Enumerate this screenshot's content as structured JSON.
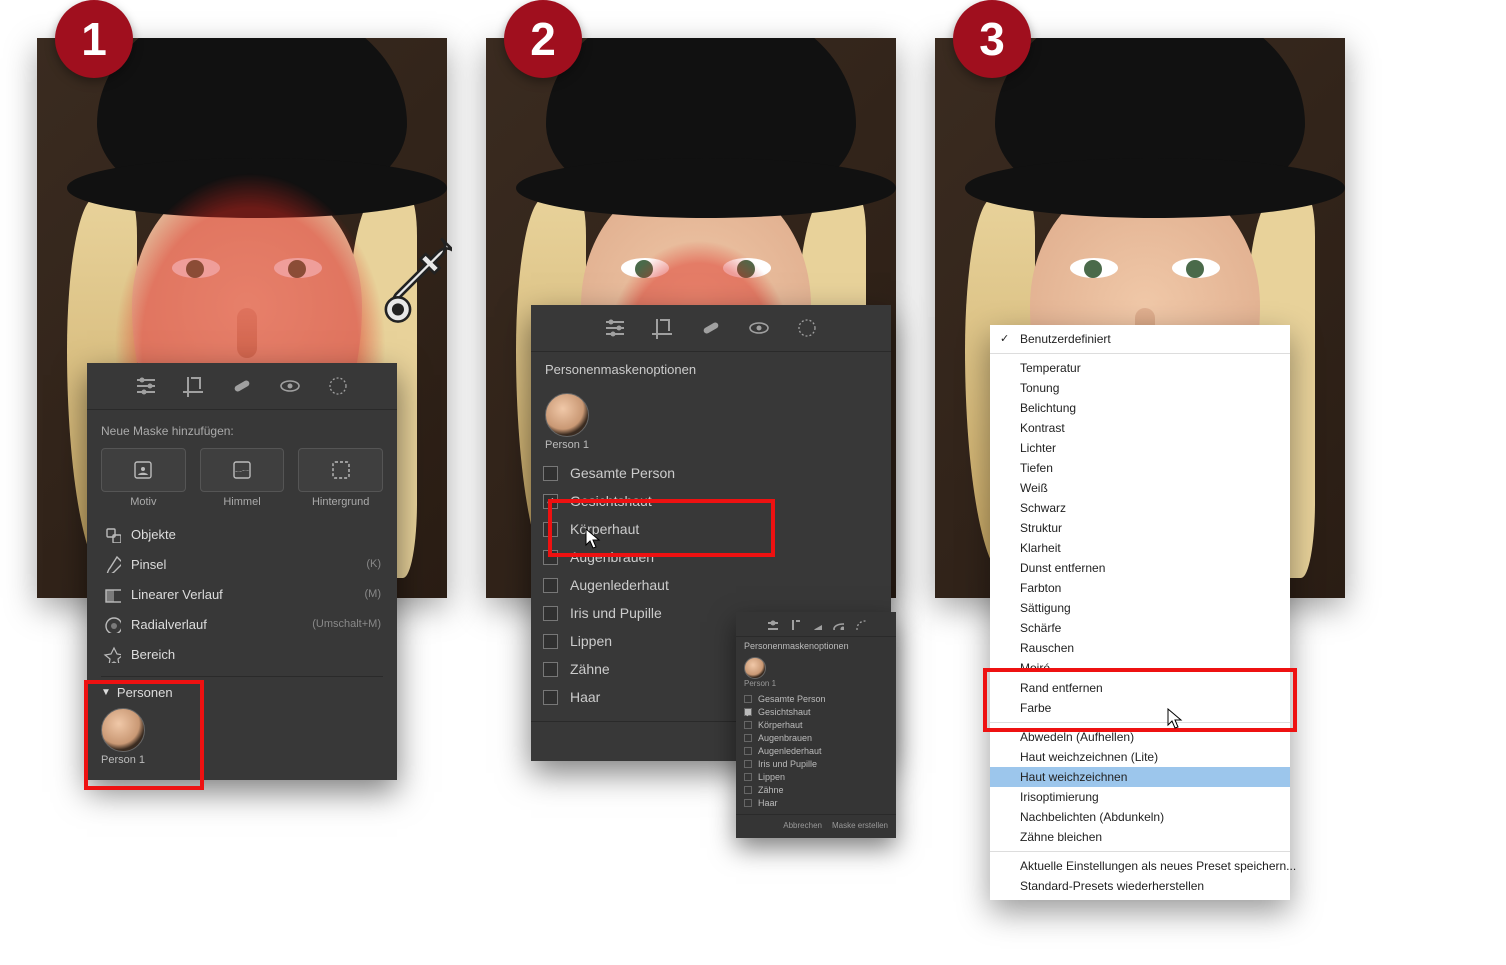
{
  "steps": {
    "s1": "1",
    "s2": "2",
    "s3": "3"
  },
  "panel1": {
    "hint": "Neue Maske hinzufügen:",
    "mask_types": {
      "motiv": "Motiv",
      "himmel": "Himmel",
      "hintergrund": "Hintergrund"
    },
    "tools": {
      "objekte": "Objekte",
      "pinsel": "Pinsel",
      "pinsel_sc": "(K)",
      "verlauf": "Linearer Verlauf",
      "verlauf_sc": "(M)",
      "radial": "Radialverlauf",
      "radial_sc": "(Umschalt+M)",
      "bereich": "Bereich"
    },
    "persons_header": "Personen",
    "person_label": "Person 1"
  },
  "panel2": {
    "title": "Personenmaskenoptionen",
    "person_label": "Person 1",
    "options": {
      "gesamte": "Gesamte Person",
      "gesichtshaut": "Gesichtshaut",
      "koerperhaut": "Körperhaut",
      "augenbrauen": "Augenbrauen",
      "augenlederhaut": "Augenlederhaut",
      "iris": "Iris und Pupille",
      "lippen": "Lippen",
      "zaehne": "Zähne",
      "haar": "Haar"
    },
    "cancel": "Abbrechen",
    "mini_footer_cancel": "Abbrechen",
    "mini_footer_create": "Maske erstellen"
  },
  "panel3": {
    "items": {
      "benutzerdef": "Benutzerdefiniert",
      "temperatur": "Temperatur",
      "tonung": "Tonung",
      "belichtung": "Belichtung",
      "kontrast": "Kontrast",
      "lichter": "Lichter",
      "tiefen": "Tiefen",
      "weiss": "Weiß",
      "schwarz": "Schwarz",
      "struktur": "Struktur",
      "klarheit": "Klarheit",
      "dunst": "Dunst entfernen",
      "farbton": "Farbton",
      "saettigung": "Sättigung",
      "schaerfe": "Schärfe",
      "rauschen": "Rauschen",
      "moire": "Moiré",
      "rand": "Rand entfernen",
      "farbe": "Farbe",
      "abwedeln": "Abwedeln (Aufhellen)",
      "hwl": "Haut weichzeichnen (Lite)",
      "hw": "Haut weichzeichnen",
      "iris": "Irisoptimierung",
      "nachbel": "Nachbelichten (Abdunkeln)",
      "zaehne": "Zähne bleichen",
      "save": "Aktuelle Einstellungen als neues Preset speichern...",
      "reset": "Standard-Presets wiederherstellen"
    }
  }
}
